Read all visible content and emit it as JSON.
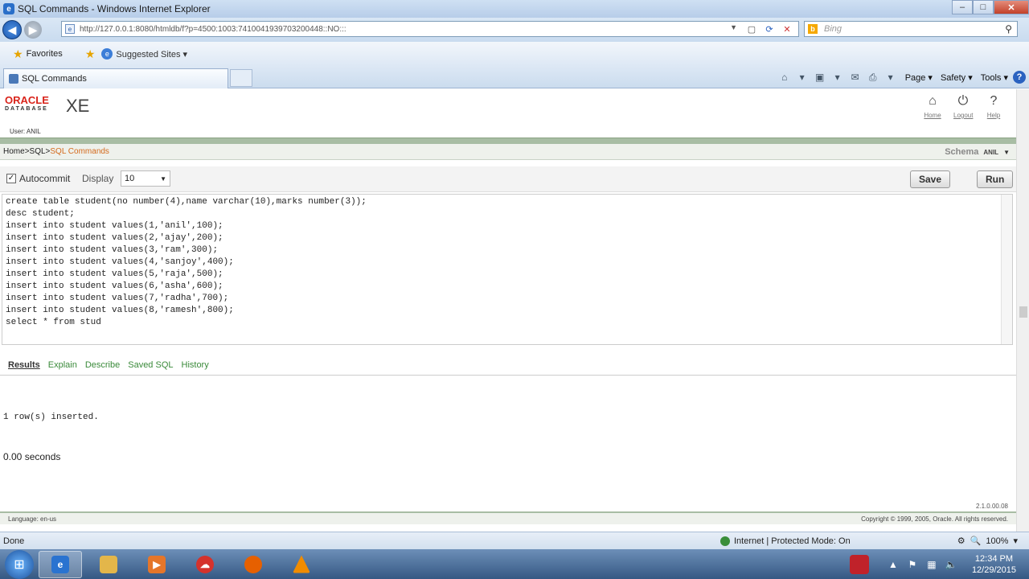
{
  "window": {
    "title": "SQL Commands - Windows Internet Explorer"
  },
  "address": {
    "url": "http://127.0.0.1:8080/htmldb/f?p=4500:1003:7410041939703200448::NO:::",
    "search_placeholder": "Bing"
  },
  "favorites": {
    "favorites_label": "Favorites",
    "suggested_label": "Suggested Sites ▾"
  },
  "tabs": {
    "active_label": "SQL Commands"
  },
  "commandbar": {
    "page": "Page ▾",
    "safety": "Safety ▾",
    "tools": "Tools ▾",
    "help": "?"
  },
  "app": {
    "logo_top": "ORACLE",
    "logo_bottom": "DATABASE",
    "edition": "XE",
    "user_line": "User: ANIL",
    "links": [
      "Home",
      "Logout",
      "Help"
    ]
  },
  "breadcrumb": {
    "home": "Home",
    "sep": " > ",
    "sql": "SQL",
    "current": "SQL Commands"
  },
  "schema": {
    "label": "Schema",
    "value": "ANIL"
  },
  "controls": {
    "autocommit_label": "Autocommit",
    "autocommit_checked": "✓",
    "display_label": "Display",
    "display_value": "10",
    "save": "Save",
    "run": "Run"
  },
  "editor": {
    "text": "create table student(no number(4),name varchar(10),marks number(3));\ndesc student;\ninsert into student values(1,'anil',100);\ninsert into student values(2,'ajay',200);\ninsert into student values(3,'ram',300);\ninsert into student values(4,'sanjoy',400);\ninsert into student values(5,'raja',500);\ninsert into student values(6,'asha',600);\ninsert into student values(7,'radha',700);\ninsert into student values(8,'ramesh',800);\nselect * from stud"
  },
  "results_tabs": [
    "Results",
    "Explain",
    "Describe",
    "Saved SQL",
    "History"
  ],
  "results": {
    "message": "1 row(s) inserted.",
    "time": "0.00 seconds"
  },
  "version": "2.1.0.00.08",
  "footer": {
    "language": "Language: en-us",
    "copyright": "Copyright © 1999, 2005, Oracle. All rights reserved."
  },
  "statusbar": {
    "left": "Done",
    "zone": "Internet | Protected Mode: On",
    "zoom": "100%"
  },
  "taskbar": {
    "time": "12:34 PM",
    "date": "12/29/2015"
  }
}
